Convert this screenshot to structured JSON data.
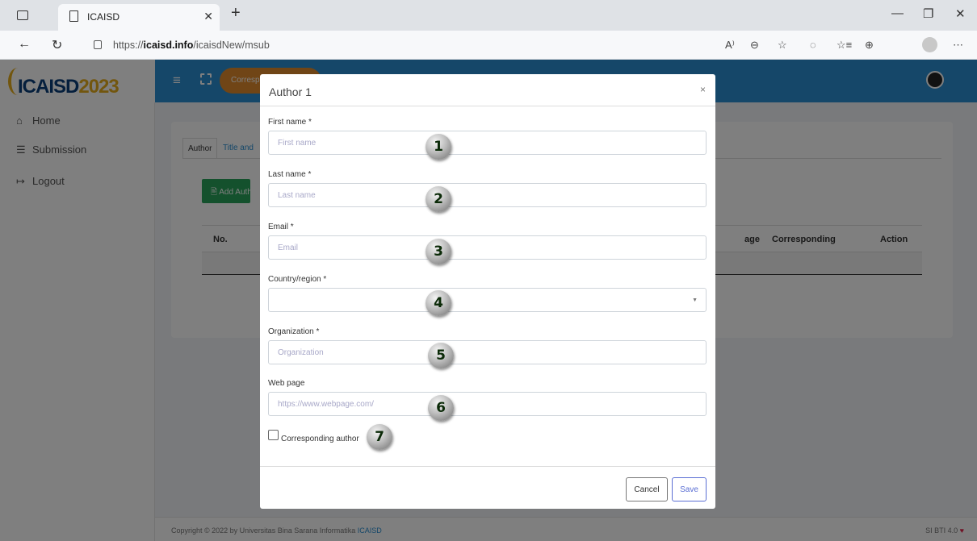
{
  "browser": {
    "tab_title": "ICAISD",
    "tab_close": "✕",
    "new_tab": "+",
    "url_prefix": "https://",
    "url_domain": "icaisd.info",
    "url_path": "/icaisdNew/msub",
    "controls": {
      "minimize": "—",
      "restore": "❐",
      "close": "✕"
    },
    "nav": {
      "back": "←",
      "refresh": "↻"
    },
    "tools": [
      "A⁾",
      "⊖",
      "☆",
      "◌",
      "☆≡",
      "⊕",
      "⋯"
    ]
  },
  "app": {
    "logo_main": "ICAISD",
    "logo_year": "2023",
    "sidebar": {
      "items": [
        {
          "icon": "⌂",
          "label": "Home"
        },
        {
          "icon": "☰",
          "label": "Submission"
        },
        {
          "icon": "↦",
          "label": "Logout"
        }
      ]
    },
    "topnav": {
      "hamburger": "≡",
      "corresponding_pill": "Corresp"
    },
    "card": {
      "tabs": [
        "Author",
        "Title and"
      ],
      "add_button": "🖹 Add Autho",
      "table": {
        "headers": [
          "No.",
          "",
          "age",
          "Corresponding",
          "Action"
        ]
      }
    },
    "footer": {
      "text": "Copyright © 2022 by Universitas Bina Sarana Informatika",
      "link": "ICAISD",
      "right_text": "SI BTI 4.0",
      "heart": "♥"
    }
  },
  "modal": {
    "title": "Author 1",
    "close": "×",
    "fields": [
      {
        "label": "First name *",
        "placeholder": "First name"
      },
      {
        "label": "Last name *",
        "placeholder": "Last name"
      },
      {
        "label": "Email *",
        "placeholder": "Email"
      },
      {
        "label": "Country/region *",
        "value": "",
        "arrow": "▼"
      },
      {
        "label": "Organization *",
        "placeholder": "Organization"
      },
      {
        "label": "Web page",
        "placeholder": "https://www.webpage.com/"
      }
    ],
    "checkbox_label": "Corresponding author",
    "cancel": "Cancel",
    "save": "Save"
  },
  "markers": [
    "1",
    "2",
    "3",
    "4",
    "5",
    "6",
    "7"
  ]
}
